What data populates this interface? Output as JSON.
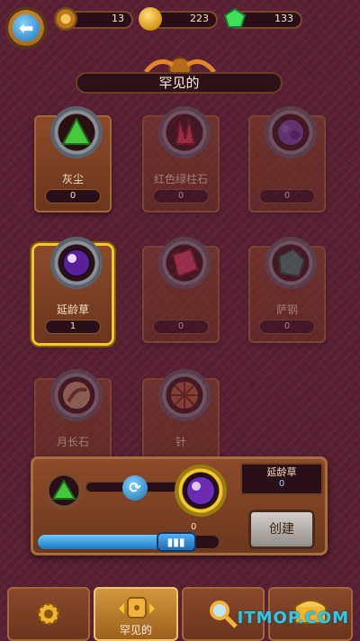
{
  "topbar": {
    "gears": "13",
    "coins": "223",
    "gems": "133"
  },
  "title": "罕见的",
  "items": [
    {
      "label": "灰尘",
      "count": "0",
      "style": "green-pyramid",
      "available": true,
      "selected": false
    },
    {
      "label": "红色绿柱石",
      "count": "0",
      "style": "red-crystal",
      "available": false,
      "selected": false
    },
    {
      "label": "",
      "count": "0",
      "style": "purple-ore",
      "available": false,
      "selected": false
    },
    {
      "label": "延龄草",
      "count": "1",
      "style": "purple-orb",
      "available": true,
      "selected": true
    },
    {
      "label": "",
      "count": "0",
      "style": "red-gem",
      "available": false,
      "selected": false
    },
    {
      "label": "萨钢",
      "count": "0",
      "style": "teal-rock",
      "available": false,
      "selected": false
    },
    {
      "label": "月长石",
      "count": "",
      "style": "moonstone",
      "available": false,
      "selected": false
    },
    {
      "label": "针",
      "count": "",
      "style": "spiky",
      "available": false,
      "selected": false
    }
  ],
  "crafting": {
    "result_name": "延龄草",
    "result_count": "0",
    "output_count": "0",
    "create_label": "创建",
    "progress": 0.76,
    "progress_knob": "▮▮▮"
  },
  "tabs": [
    {
      "label": "",
      "icon": "gear-icon"
    },
    {
      "label": "罕见的",
      "icon": "dice-icon",
      "active": true
    },
    {
      "label": "",
      "icon": "magnifier-icon"
    },
    {
      "label": "",
      "icon": "chest-icon"
    }
  ],
  "watermark": "ITMOP.COM",
  "colors": {
    "background": "#5a1f33",
    "card": "#7a3f22",
    "accent_selected": "#f3c62a",
    "watermark": "#31c7e6"
  }
}
